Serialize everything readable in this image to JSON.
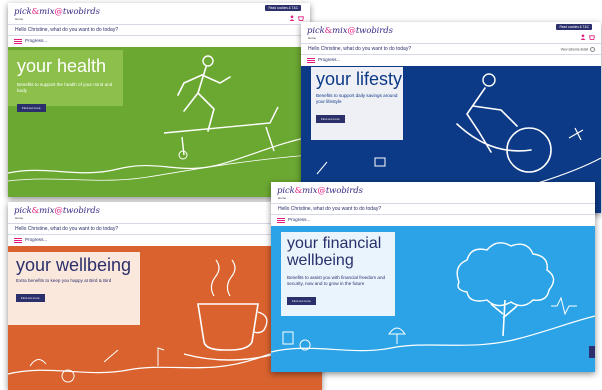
{
  "brand": {
    "logo_pre": "pick",
    "logo_amp": "&",
    "logo_mid": "mix",
    "logo_at": "@",
    "logo_post": "twobirds"
  },
  "nav": {
    "home": "Home",
    "greeting": "Hello Christine, what do you want to do today?",
    "progress": "Progress...",
    "top_button": "Read cookies & T&C",
    "right_link": "View scheme detail"
  },
  "hero_button": "Find out more",
  "panels": {
    "health": {
      "title": "your health",
      "desc": "Benefits to support the health of your mind and body"
    },
    "lifestyle": {
      "title": "your lifestyle",
      "desc": "Benefits to support daily savings around your lifestyle"
    },
    "wellbeing": {
      "title": "your wellbeing",
      "desc": "Extra benefits to keep you happy at Bird & Bird"
    },
    "financial": {
      "title": "your financial wellbeing",
      "desc": "Benefits to assist you with financial freedom and security, now and to grow in the future"
    }
  },
  "colors": {
    "health_bg": "#6ba832",
    "lifestyle_bg": "#0c3a86",
    "wellbeing_bg": "#d9622e",
    "financial_bg": "#2ba3e6",
    "brand_navy": "#2b2f6b",
    "brand_pink": "#e31d7d"
  },
  "icons": [
    "menu-icon",
    "user-icon",
    "basket-icon",
    "treadmill-runner-icon",
    "cyclist-icon",
    "coffee-cup-icon",
    "tree-icon",
    "bike-icon",
    "umbrella-icon",
    "piggy-bank-icon",
    "heartbeat-icon",
    "guitar-icon",
    "microphone-icon"
  ]
}
